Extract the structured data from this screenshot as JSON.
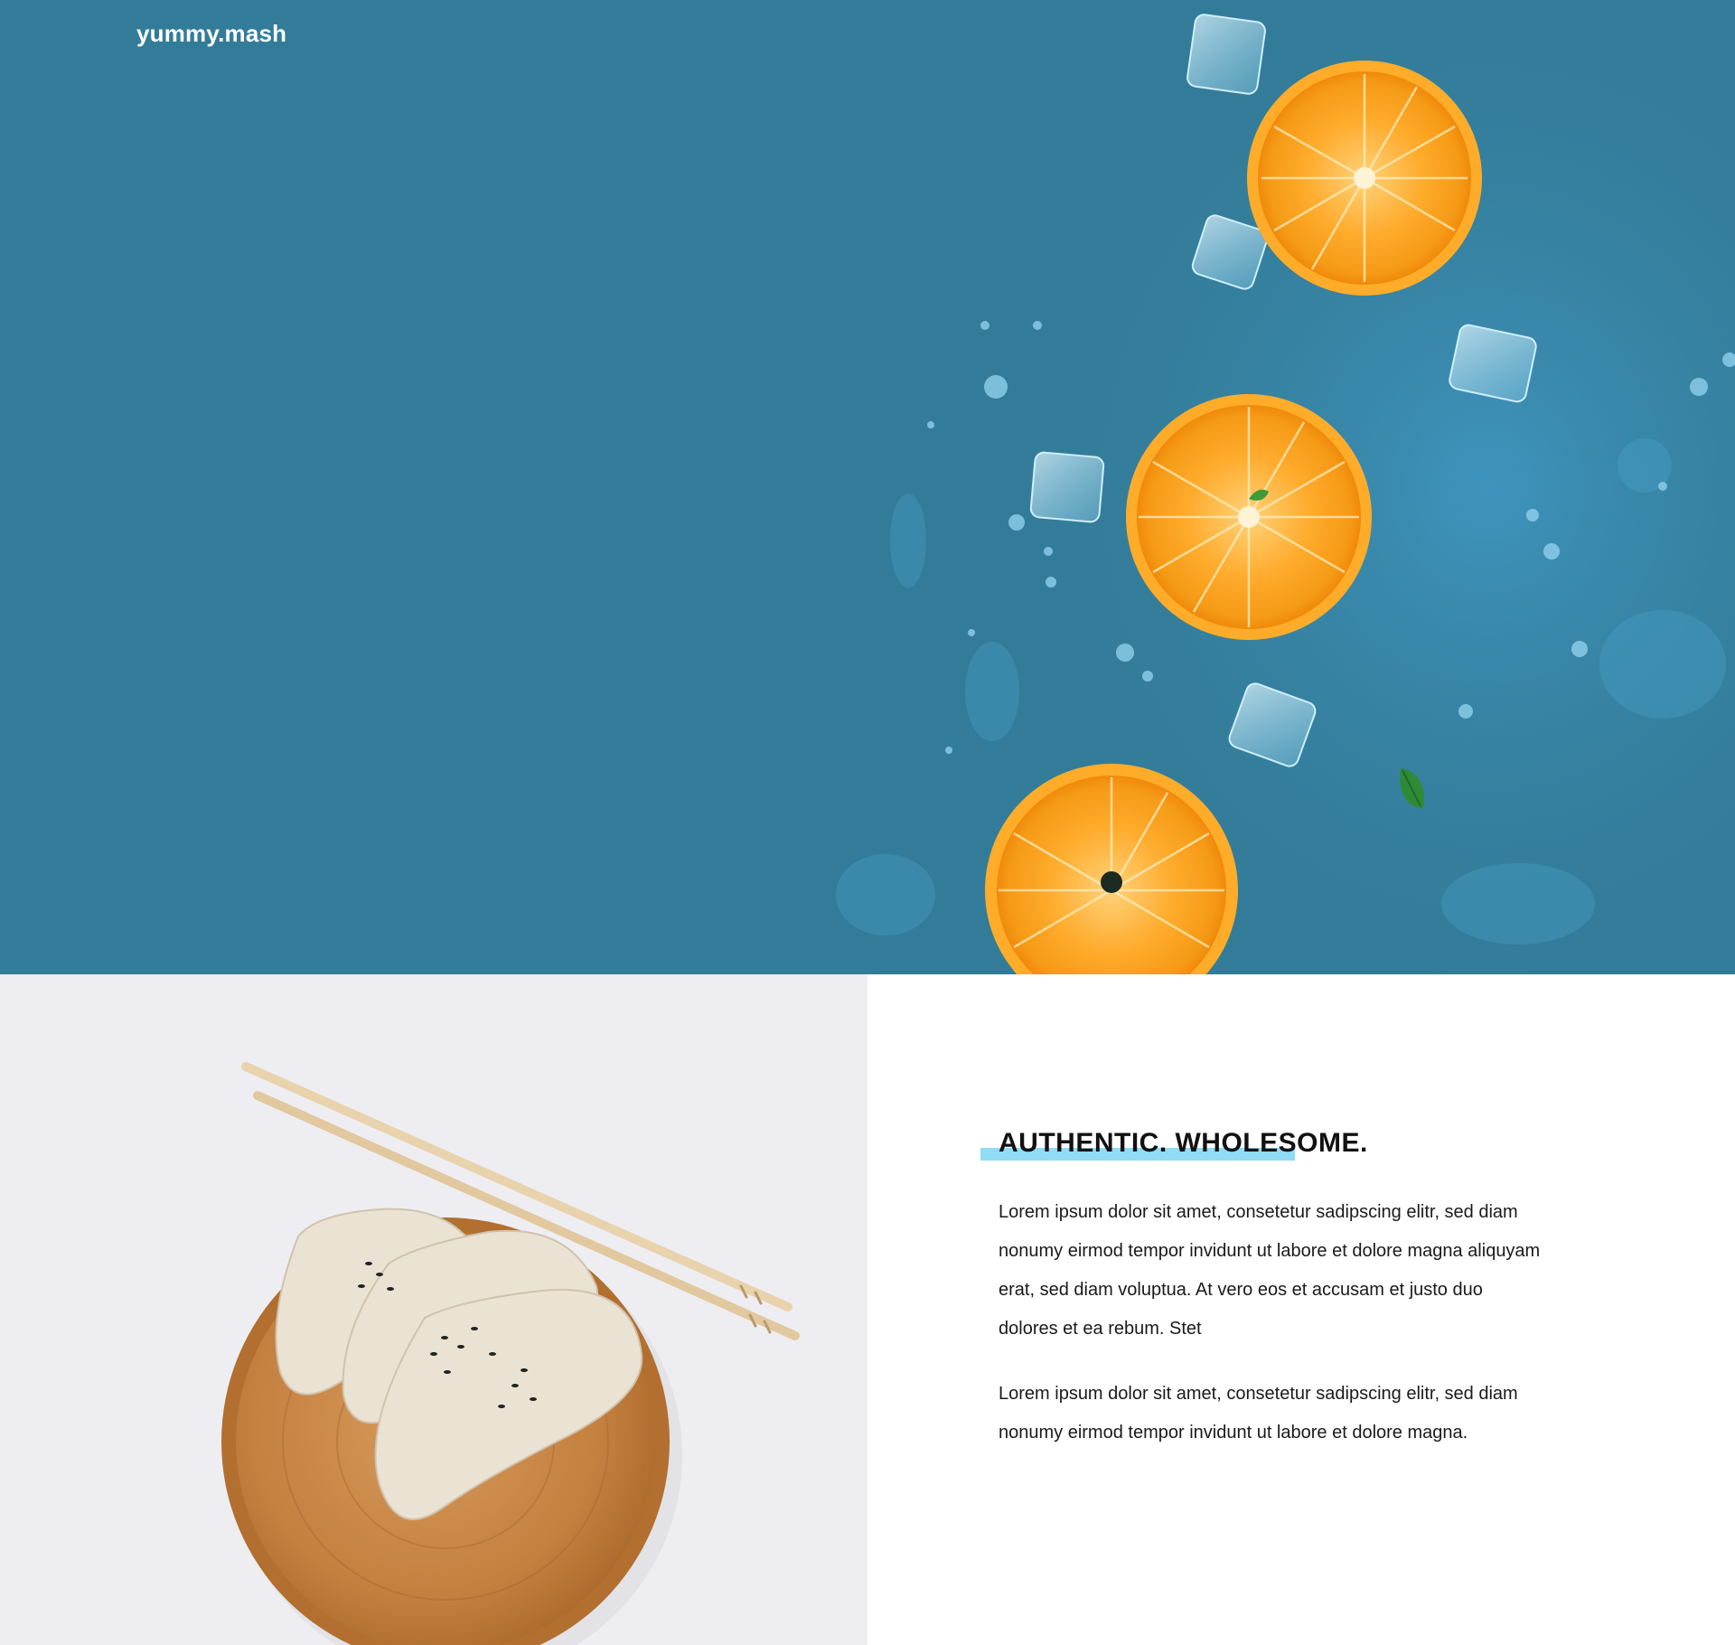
{
  "brand": {
    "logo": "yummy.mash"
  },
  "hero": {
    "background_color": "#337c99",
    "image": "orange-slices-ice-cubes-on-blue"
  },
  "feature": {
    "image": "dumplings-on-wooden-plate-with-chopsticks",
    "headline": "AUTHENTIC. WHOLESOME.",
    "highlight_color": "#8fdcf4",
    "paragraphs": [
      "Lorem ipsum dolor sit amet, consetetur sadipscing elitr, sed diam nonumy eirmod tempor invidunt ut labore et dolore magna aliquyam erat, sed diam voluptua. At vero eos et accusam et justo duo dolores et ea rebum. Stet",
      "Lorem ipsum dolor sit amet, consetetur sadipscing elitr, sed diam nonumy eirmod tempor invidunt ut labore et dolore magna."
    ]
  }
}
